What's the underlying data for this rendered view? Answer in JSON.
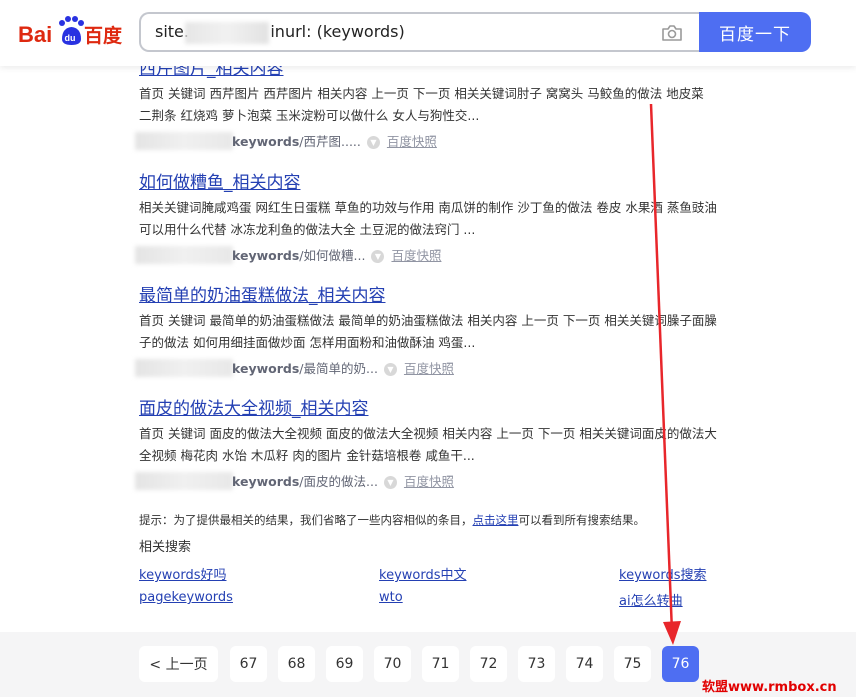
{
  "brand": {
    "logo_text_left": "Bai",
    "logo_text_paw": "du",
    "logo_text_right": "百度",
    "accent": "#4e6ef2",
    "logo_red": "#de2910",
    "logo_blue": "#2932e1"
  },
  "search": {
    "query": "site.              , inurl: (keywords)",
    "button_label": "百度一下",
    "camera_icon": "camera-icon"
  },
  "results": [
    {
      "title": "西芹图片_相关内容",
      "desc": "首页 关键词 西芹图片 西芹图片 相关内容 上一页 下一页 相关关键词肘子 窝窝头 马鲛鱼的做法 地皮菜 二荆条 红烧鸡 萝卜泡菜 玉米淀粉可以做什么 女人与狗性交...",
      "url_bold": "keywords",
      "url_rest": "/西芹图.....",
      "cache": "百度快照"
    },
    {
      "title": "如何做糟鱼_相关内容",
      "desc": "相关关键词腌咸鸡蛋 网红生日蛋糕 草鱼的功效与作用 南瓜饼的制作 沙丁鱼的做法 卷皮 水果酒 蒸鱼豉油可以用什么代替 冰冻龙利鱼的做法大全 土豆泥的做法窍门 ...",
      "url_bold": "keywords",
      "url_rest": "/如何做糟...",
      "cache": "百度快照"
    },
    {
      "title": "最简单的奶油蛋糕做法_相关内容",
      "desc": "首页 关键词 最简单的奶油蛋糕做法 最简单的奶油蛋糕做法 相关内容 上一页 下一页 相关关键词臊子面臊子的做法 如何用细挂面做炒面 怎样用面粉和油做酥油 鸡蛋...",
      "url_bold": "keywords",
      "url_rest": "/最简单的奶...",
      "cache": "百度快照"
    },
    {
      "title": "面皮的做法大全视频_相关内容",
      "desc": "首页 关键词 面皮的做法大全视频 面皮的做法大全视频 相关内容 上一页 下一页 相关关键词面皮的做法大全视频 梅花肉 水饴 木瓜籽 肉的图片 金针菇培根卷 咸鱼干...",
      "url_bold": "keywords",
      "url_rest": "/面皮的做法...",
      "cache": "百度快照"
    }
  ],
  "tip": {
    "prefix": "提示：为了提供最相关的结果，我们省略了一些内容相似的条目，",
    "link": "点击这里",
    "suffix": "可以看到所有搜索结果。"
  },
  "related": {
    "title": "相关搜索",
    "links": [
      "keywords好吗",
      "keywords中文",
      "keywords搜索",
      "pagekeywords",
      "wto",
      "ai怎么转曲"
    ]
  },
  "pagination": {
    "prev": "< 上一页",
    "pages": [
      "67",
      "68",
      "69",
      "70",
      "71",
      "72",
      "73",
      "74",
      "75",
      "76"
    ],
    "current": "76"
  },
  "watermark": "软盟www.rmbox.cn"
}
